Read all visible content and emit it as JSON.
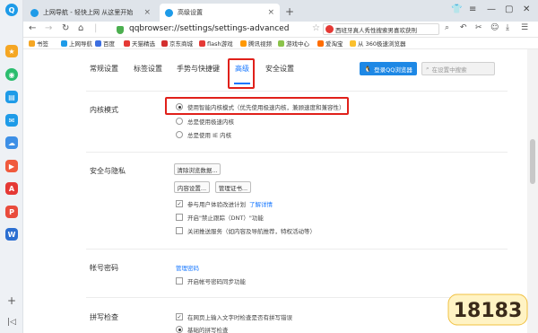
{
  "tabs": [
    {
      "title": "上网导航 - 轻快上网 从这里开始"
    },
    {
      "title": "高级设置"
    }
  ],
  "address": {
    "url": "qqbrowser://settings/settings-advanced",
    "search_text": "西班牙真人秀性搜索男喜欢获刑"
  },
  "bookmarks": [
    {
      "label": "书签"
    },
    {
      "label": "上网导航"
    },
    {
      "label": "百度"
    },
    {
      "label": "天猫精选"
    },
    {
      "label": "京东商城"
    },
    {
      "label": "flash游戏"
    },
    {
      "label": "腾讯视频"
    },
    {
      "label": "游戏中心"
    },
    {
      "label": "爱淘宝"
    },
    {
      "label": "从 360极速浏览器"
    }
  ],
  "settings_nav": [
    {
      "label": "常规设置"
    },
    {
      "label": "标签设置"
    },
    {
      "label": "手势与快捷键"
    },
    {
      "label": "高级"
    },
    {
      "label": "安全设置"
    }
  ],
  "login_button": "登录QQ浏览器",
  "settings_search_placeholder": "在设置中搜索",
  "kernel": {
    "title": "内核模式",
    "options": [
      {
        "label": "使用智能内核模式（优先使用极速内核，兼顾速度和兼容性）",
        "selected": true
      },
      {
        "label": "总是使用极速内核",
        "selected": false
      },
      {
        "label": "总是使用 IE 内核",
        "selected": false
      }
    ]
  },
  "privacy": {
    "title": "安全与隐私",
    "clear_button": "清除浏览数据...",
    "content_button": "内容设置...",
    "cert_button": "管理证书...",
    "options": [
      {
        "label": "参与用户体验改进计划",
        "checked": true,
        "link": "了解详情"
      },
      {
        "label": "开启\"禁止跟踪（DNT）\"功能",
        "checked": false
      },
      {
        "label": "关闭推送服务（如内容及导航推荐，特权活动等）",
        "checked": false
      }
    ]
  },
  "account": {
    "title": "帐号密码",
    "manage_link": "管理密码",
    "options": [
      {
        "label": "开启帐号密码同步功能",
        "checked": false
      }
    ]
  },
  "spell": {
    "title": "拼写检查",
    "options": [
      {
        "label": "在网页上输入文字时检查是否有拼写错误",
        "checked": true
      },
      {
        "label": "基础的拼写检查",
        "selected": true
      }
    ]
  },
  "watermark": {
    "text": "18183"
  }
}
